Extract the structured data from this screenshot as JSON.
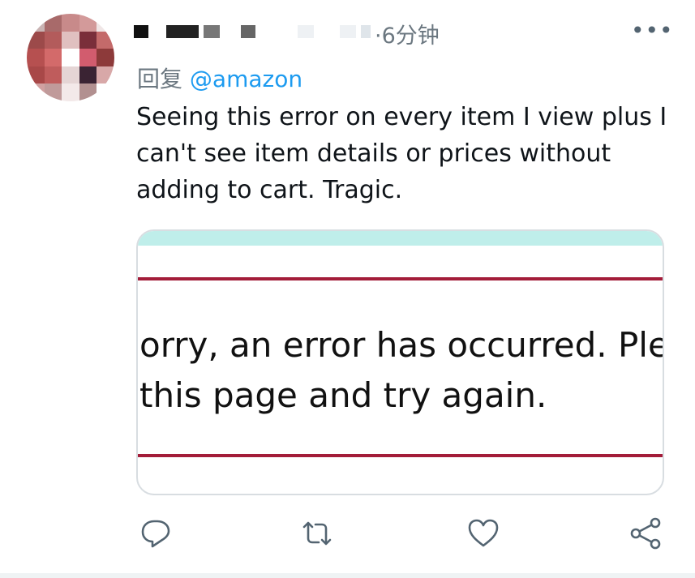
{
  "tweet": {
    "time": "·6分钟",
    "reply_prefix": "回复",
    "reply_handle": "@amazon",
    "text": "Seeing this error on every item I view plus I can't see item details or prices without adding to cart. Tragic.",
    "more_label": "•••"
  },
  "card": {
    "error_line1": "orry, an error has occurred. Ple",
    "error_line2": "this page and try again."
  },
  "actions": {
    "icons": [
      "reply-icon",
      "retweet-icon",
      "like-icon",
      "share-icon"
    ]
  },
  "colors": {
    "link": "#1d9bf0",
    "muted": "#6b7780",
    "amazon_rule": "#a31c39",
    "card_header": "#bfeeea"
  }
}
